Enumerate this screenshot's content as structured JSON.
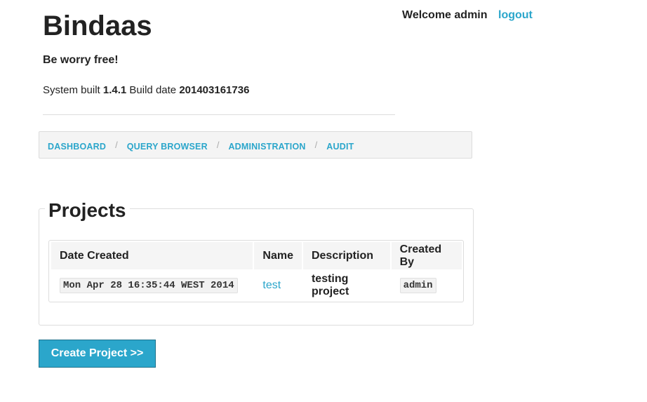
{
  "header": {
    "app_title": "Bindaas",
    "tagline": "Be worry free!",
    "build": {
      "prefix": "System built",
      "version": "1.4.1",
      "date_label": "Build date",
      "date_value": "201403161736"
    },
    "welcome_text": "Welcome admin",
    "logout_label": "logout"
  },
  "breadcrumbs": [
    {
      "label": "DASHBOARD"
    },
    {
      "label": "QUERY BROWSER"
    },
    {
      "label": "ADMINISTRATION"
    },
    {
      "label": "AUDIT"
    }
  ],
  "breadcrumb_separator": "/",
  "projects": {
    "title": "Projects",
    "columns": [
      "Date Created",
      "Name",
      "Description",
      "Created By"
    ],
    "rows": [
      {
        "date_created": "Mon Apr 28 16:35:44 WEST 2014",
        "name": "test",
        "description": "testing project",
        "created_by": "admin"
      }
    ]
  },
  "actions": {
    "create_project_label": "Create Project >>"
  },
  "colors": {
    "accent": "#2ba6cb",
    "text": "#222222",
    "panel_border": "#dddddd",
    "breadcrumb_bg": "#f4f4f4"
  }
}
